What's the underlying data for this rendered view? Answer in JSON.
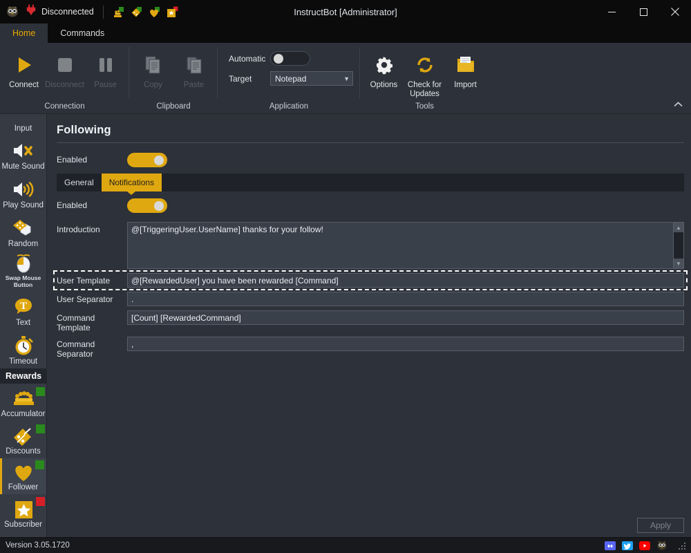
{
  "window": {
    "title": "InstructBot [Administrator]",
    "connection_status": "Disconnected",
    "minimize": "─",
    "maximize": "□",
    "close": "✕",
    "logo_icon": "owl-logo-icon",
    "status_icon": "plug-disconnected-icon",
    "quick_icons": [
      {
        "name": "accumulator-quick-icon"
      },
      {
        "name": "discounts-quick-icon"
      },
      {
        "name": "follower-quick-icon"
      },
      {
        "name": "subscriber-quick-icon"
      }
    ]
  },
  "ribbon": {
    "tabs": [
      {
        "label": "Home",
        "active": true
      },
      {
        "label": "Commands",
        "active": false
      }
    ],
    "collapse_icon": "chevron-up-icon",
    "groups": [
      {
        "label": "Connection",
        "buttons": [
          {
            "label": "Connect",
            "icon": "play-icon",
            "disabled": false
          },
          {
            "label": "Disconnect",
            "icon": "stop-icon",
            "disabled": true
          },
          {
            "label": "Pause",
            "icon": "pause-icon",
            "disabled": true
          }
        ]
      },
      {
        "label": "Clipboard",
        "buttons": [
          {
            "label": "Copy",
            "icon": "copy-icon",
            "disabled": true
          },
          {
            "label": "Paste",
            "icon": "paste-icon",
            "disabled": true
          }
        ]
      },
      {
        "label": "Application",
        "automatic_label": "Automatic",
        "automatic_on": false,
        "target_label": "Target",
        "target_value": "Notepad",
        "target_arrow": "▼"
      },
      {
        "label": "Tools",
        "buttons": [
          {
            "label": "Options",
            "icon": "gear-icon",
            "disabled": false
          },
          {
            "label": "Check for\nUpdates",
            "icon": "refresh-icon",
            "disabled": false
          },
          {
            "label": "Import",
            "icon": "folder-open-icon",
            "disabled": false
          }
        ]
      }
    ]
  },
  "sidebar": {
    "items": [
      {
        "label": "Input",
        "icon": "input-icon",
        "partial": true,
        "selected": false,
        "badge": null
      },
      {
        "label": "Mute Sound",
        "icon": "mute-sound-icon",
        "selected": false,
        "badge": null
      },
      {
        "label": "Play Sound",
        "icon": "play-sound-icon",
        "selected": false,
        "badge": null
      },
      {
        "label": "Random",
        "icon": "dice-icon",
        "selected": false,
        "badge": null
      },
      {
        "label": "Swap Mouse\nButton",
        "icon": "swap-mouse-button-icon",
        "selected": false,
        "badge": null,
        "small_label": true
      },
      {
        "label": "Text",
        "icon": "text-bubble-icon",
        "selected": false,
        "badge": null
      },
      {
        "label": "Timeout",
        "icon": "stopwatch-icon",
        "selected": false,
        "badge": null
      }
    ],
    "section_header": "Rewards",
    "reward_items": [
      {
        "label": "Accumulator",
        "icon": "accumulator-icon",
        "selected": false,
        "badge": "#2a8a1e"
      },
      {
        "label": "Discounts",
        "icon": "discount-tag-icon",
        "selected": false,
        "badge": "#2a8a1e"
      },
      {
        "label": "Follower",
        "icon": "heart-icon",
        "selected": true,
        "badge": "#2a8a1e"
      },
      {
        "label": "Subscriber",
        "icon": "star-icon",
        "selected": false,
        "badge": "#d61f26"
      }
    ]
  },
  "panel": {
    "title": "Following",
    "enabled_label": "Enabled",
    "enabled_on": true,
    "tabs": [
      {
        "label": "General",
        "active": false
      },
      {
        "label": "Notifications",
        "active": true
      }
    ],
    "notifications": {
      "enabled_label": "Enabled",
      "enabled_on": true,
      "fields": [
        {
          "label": "Introduction",
          "value": "@[TriggeringUser.UserName] thanks for your follow!",
          "type": "textarea",
          "focused": false
        },
        {
          "label": "User Template",
          "value": "@[RewardedUser] you have been rewarded [Command]",
          "type": "text",
          "focused": true
        },
        {
          "label": "User Separator",
          "value": ".",
          "type": "text",
          "focused": false
        },
        {
          "label": "Command Template",
          "value": "[Count] [RewardedCommand]",
          "type": "text",
          "focused": false
        },
        {
          "label": "Command Separator",
          "value": ",",
          "type": "text",
          "focused": false
        }
      ]
    },
    "apply_label": "Apply",
    "apply_enabled": false
  },
  "statusbar": {
    "version": "Version 3.05.1720",
    "icons": [
      {
        "name": "discord-icon",
        "color": "#5865f2"
      },
      {
        "name": "twitter-icon",
        "color": "#1da1f2"
      },
      {
        "name": "youtube-icon",
        "color": "#ff0000"
      },
      {
        "name": "owl-logo-icon",
        "color": "#e0a810"
      }
    ],
    "grip_icon": "resize-grip-icon"
  },
  "colors": {
    "accent": "#e0a810",
    "window_bg": "#2d3139",
    "sidebar_bg": "#353a43",
    "titlebar_bg": "#0b0b0b",
    "status_ok": "#2a8a1e",
    "status_error": "#d61f26"
  }
}
